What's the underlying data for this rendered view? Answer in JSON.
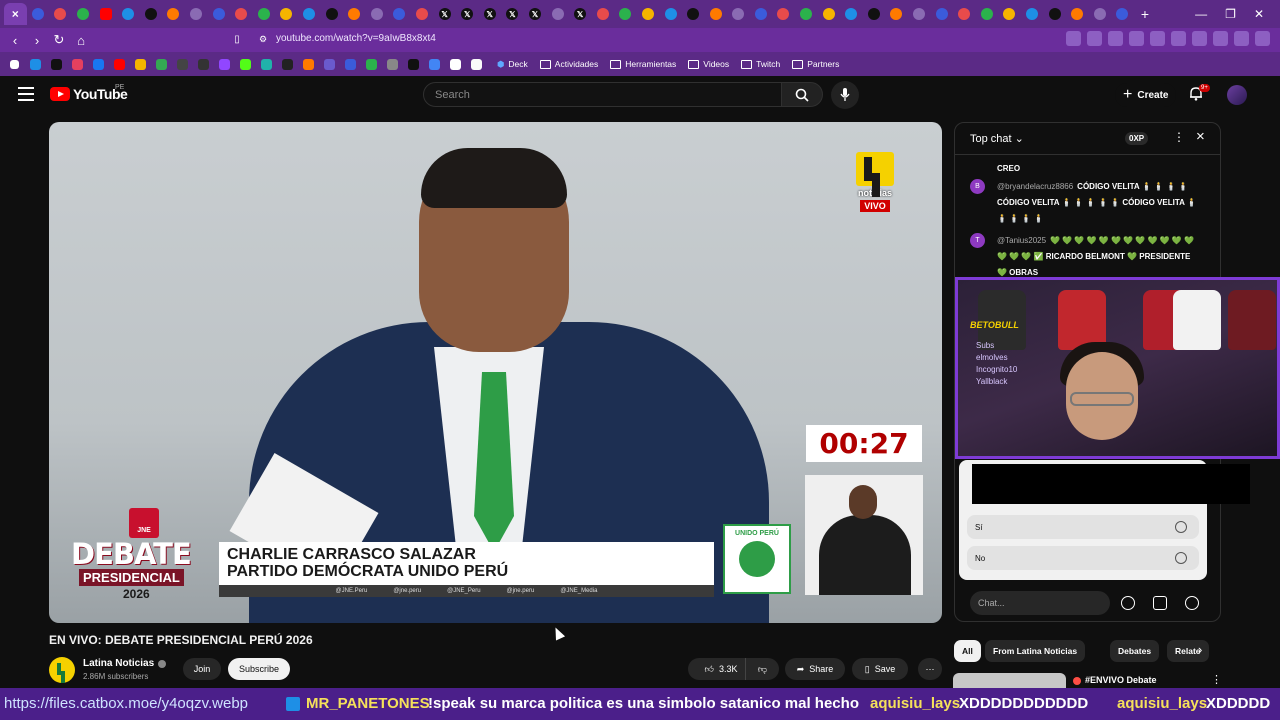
{
  "browser": {
    "url": "youtube.com/watch?v=9aIwB8x8xt4",
    "tab_icons": [
      "close",
      "circle",
      "circle",
      "circle",
      "youtube",
      "circle",
      "circle",
      "circle",
      "circle",
      "circle",
      "circle",
      "circle",
      "circle",
      "circle",
      "circle",
      "bookmark",
      "circle",
      "circle",
      "circle",
      "x",
      "x",
      "x",
      "x",
      "x",
      "circle",
      "x",
      "circle",
      "circle",
      "circle",
      "circle",
      "circle",
      "circle",
      "circle",
      "circle",
      "circle",
      "tiktok",
      "circle",
      "circle",
      "circle",
      "w",
      "k",
      "circle",
      "circle",
      "circle",
      "circle",
      "circle",
      "circle",
      "circle",
      "circle",
      "circle"
    ],
    "new_tab_label": "+",
    "bookmarks": [
      {
        "label": "Deck"
      },
      {
        "label": "Actividades"
      },
      {
        "label": "Herramientas"
      },
      {
        "label": "Videos"
      },
      {
        "label": "Twitch"
      },
      {
        "label": "Partners"
      }
    ]
  },
  "youtube": {
    "logo_text": "YouTube",
    "country_code": "PE",
    "search_placeholder": "Search",
    "create_label": "Create",
    "notif_badge": "9+"
  },
  "video": {
    "channel_mark_text": "noticias",
    "live_label": "VIVO",
    "timer": "00:27",
    "lower_third_name": "CHARLIE CARRASCO SALAZAR",
    "lower_third_party": "PARTIDO DEMÓCRATA UNIDO PERÚ",
    "social_handles": [
      "@JNE.Peru",
      "@jne.peru",
      "@JNE_Peru",
      "@jne.peru",
      "@JNE_Media"
    ],
    "party_logo_text": "UNIDO PERÚ",
    "debate_word": "DEBATE",
    "presidencial_word": "PRESIDENCIAL",
    "year_word": "2026",
    "jne_label": "JNE"
  },
  "meta": {
    "title": "EN VIVO: DEBATE PRESIDENCIAL PERÚ 2026",
    "channel": "Latina Noticias",
    "subscribers": "2.86M subscribers",
    "join_label": "Join",
    "subscribe_label": "Subscribe",
    "likes": "3.3K",
    "share_label": "Share",
    "save_label": "Save"
  },
  "chat": {
    "title": "Top chat",
    "xp": "0XP",
    "messages": [
      {
        "avatar": "",
        "author": "",
        "text": "CREO",
        "avatar_color": "#0f0f0f"
      },
      {
        "avatar": "B",
        "author": "@bryandelacruz8866",
        "text": "CÓDIGO VELITA 🕯️ 🕯️ 🕯️ 🕯️ CÓDIGO VELITA 🕯️ 🕯️ 🕯️ 🕯️ 🕯️ CÓDIGO VELITA 🕯️ 🕯️ 🕯️ 🕯️ 🕯️",
        "avatar_color": "#8e3ac1"
      },
      {
        "avatar": "T",
        "author": "@Tanius2025",
        "text": "💚 💚 💚 💚 💚 💚 💚 💚 💚 💚 💚 💚 💚 💚 💚 ✅ RICARDO BELMONT 💚 PRESIDENTE 💚 OBRAS",
        "avatar_color": "#8e3ac1"
      }
    ],
    "stream_overlay_brand": "BETOBULL",
    "stream_overlay_subs": [
      "Subs",
      "elmolves",
      "Incognito10",
      "Yallblack"
    ],
    "poll_options": [
      "Sí",
      "No"
    ],
    "input_placeholder": "Chat..."
  },
  "chips": [
    "All",
    "From Latina Noticias",
    "Debates",
    "Relate"
  ],
  "recommendation": {
    "title": "#ENVIVO Debate"
  },
  "ticker": {
    "url": "https://files.catbox.moe/y4oqzv.webp",
    "user1": "MR_PANETONES",
    "msg1": "!speak su marca politica es una simbolo satanico mal hecho",
    "user2": "aquisiu_lays",
    "msg2": "XDDDDDDDDDDD",
    "user3": "aquisiu_lays",
    "msg3": "XDDDDD"
  },
  "colors": {
    "browser_purple": "#5b2a86",
    "youtube_red": "#ff0000",
    "tie_green": "#2e9d47",
    "latina_yellow": "#f5d100"
  }
}
